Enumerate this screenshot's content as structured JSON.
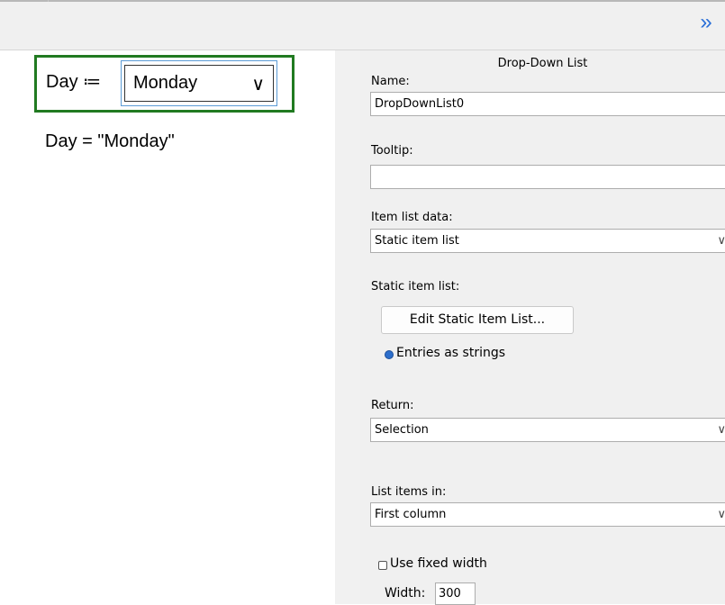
{
  "toolbar": {
    "collapse_glyph": "»"
  },
  "worksheet": {
    "variable_label": "Day ≔",
    "dropdown_value": "Monday",
    "dropdown_chevron": "∨",
    "result_text": "Day = \"Monday\""
  },
  "panel": {
    "title": "Drop-Down List",
    "name_label": "Name:",
    "name_value": "DropDownList0",
    "tooltip_label": "Tooltip:",
    "tooltip_value": "",
    "item_list_data_label": "Item list data:",
    "item_list_data_value": "Static item list",
    "static_item_list_label": "Static item list:",
    "edit_button_label": "Edit Static Item List...",
    "entries_as_strings_label": "Entries as strings",
    "return_label": "Return:",
    "return_value": "Selection",
    "list_items_in_label": "List items in:",
    "list_items_in_value": "First column",
    "use_fixed_width_label": "Use fixed width",
    "width_label": "Width:",
    "width_value": "300",
    "select_chevron": "∨"
  },
  "colors": {
    "region_border": "#217a21",
    "selection_border": "#5b9bd5",
    "accent": "#2a6fd8",
    "panel_bg": "#f0f0f0"
  }
}
